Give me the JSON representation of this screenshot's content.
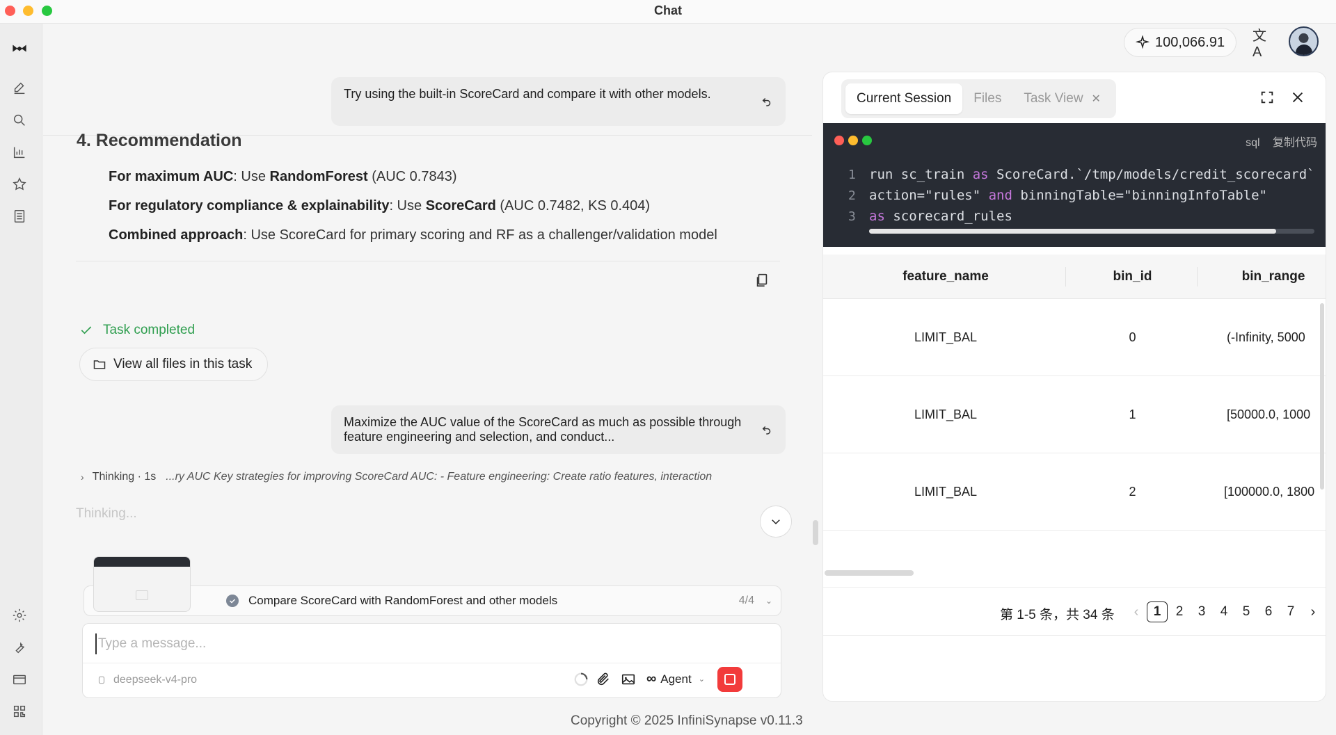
{
  "window": {
    "title": "Chat"
  },
  "header": {
    "credits": "100,066.91"
  },
  "chat": {
    "user_message_1": "Try using the built-in ScoreCard and compare it with other models.",
    "recommendation_title": "4. Recommendation",
    "rec_1_label": "For maximum AUC",
    "rec_1_text_a": ": Use ",
    "rec_1_model": "RandomForest",
    "rec_1_text_b": " (AUC 0.7843)",
    "rec_2_label": "For regulatory compliance & explainability",
    "rec_2_text_a": ": Use ",
    "rec_2_model": "ScoreCard",
    "rec_2_text_b": " (AUC 0.7482, KS 0.404)",
    "rec_3_label": "Combined approach",
    "rec_3_text": ": Use ScoreCard for primary scoring and RF as a challenger/validation model",
    "task_completed": "Task completed",
    "view_files": "View all files in this task",
    "user_message_2": "Maximize the AUC value of the ScoreCard as much as possible through feature engineering and selection, and conduct...",
    "thinking_label": "Thinking · 1s",
    "thinking_snippet": "...ry AUC Key strategies for improving ScoreCard AUC: - Feature engineering: Create ratio features, interaction",
    "thinking_ghost": "Thinking..."
  },
  "composer": {
    "task_label": "Compare ScoreCard with RandomForest and other models",
    "task_count": "4/4",
    "placeholder": "Type a message...",
    "model": "deepseek-v4-pro",
    "agent": "Agent"
  },
  "footer": {
    "copyright": "Copyright © 2025 InfiniSynapse v0.11.3"
  },
  "panel": {
    "tabs": [
      {
        "label": "Current Session",
        "active": true
      },
      {
        "label": "Files",
        "active": false
      },
      {
        "label": "Task View",
        "active": false
      }
    ],
    "code": {
      "language": "sql",
      "copy_label": "复制代码",
      "lines": [
        {
          "n": "1",
          "a": "run sc_train ",
          "k": "as",
          "b": " ScoreCard.`/tmp/models/credit_scorecard`"
        },
        {
          "n": "2",
          "a": "action=\"rules\" ",
          "k": "and",
          "b": " binningTable=\"binningInfoTable\""
        },
        {
          "n": "3",
          "a": "",
          "k": "as",
          "b": " scorecard_rules"
        }
      ]
    },
    "table": {
      "columns": [
        "feature_name",
        "bin_id",
        "bin_range"
      ],
      "rows": [
        [
          "LIMIT_BAL",
          "0",
          "(-Infinity, 5000"
        ],
        [
          "LIMIT_BAL",
          "1",
          "[50000.0, 1000"
        ],
        [
          "LIMIT_BAL",
          "2",
          "[100000.0, 1800"
        ]
      ]
    },
    "pagination": {
      "summary": "第 1-5 条，共 34 条",
      "pages": [
        "1",
        "2",
        "3",
        "4",
        "5",
        "6",
        "7"
      ],
      "current": "1"
    }
  },
  "colors": {
    "accent_green": "#2f9e4f",
    "stop_red": "#f23b3b",
    "code_bg": "#282c34",
    "keyword": "#c678dd"
  }
}
